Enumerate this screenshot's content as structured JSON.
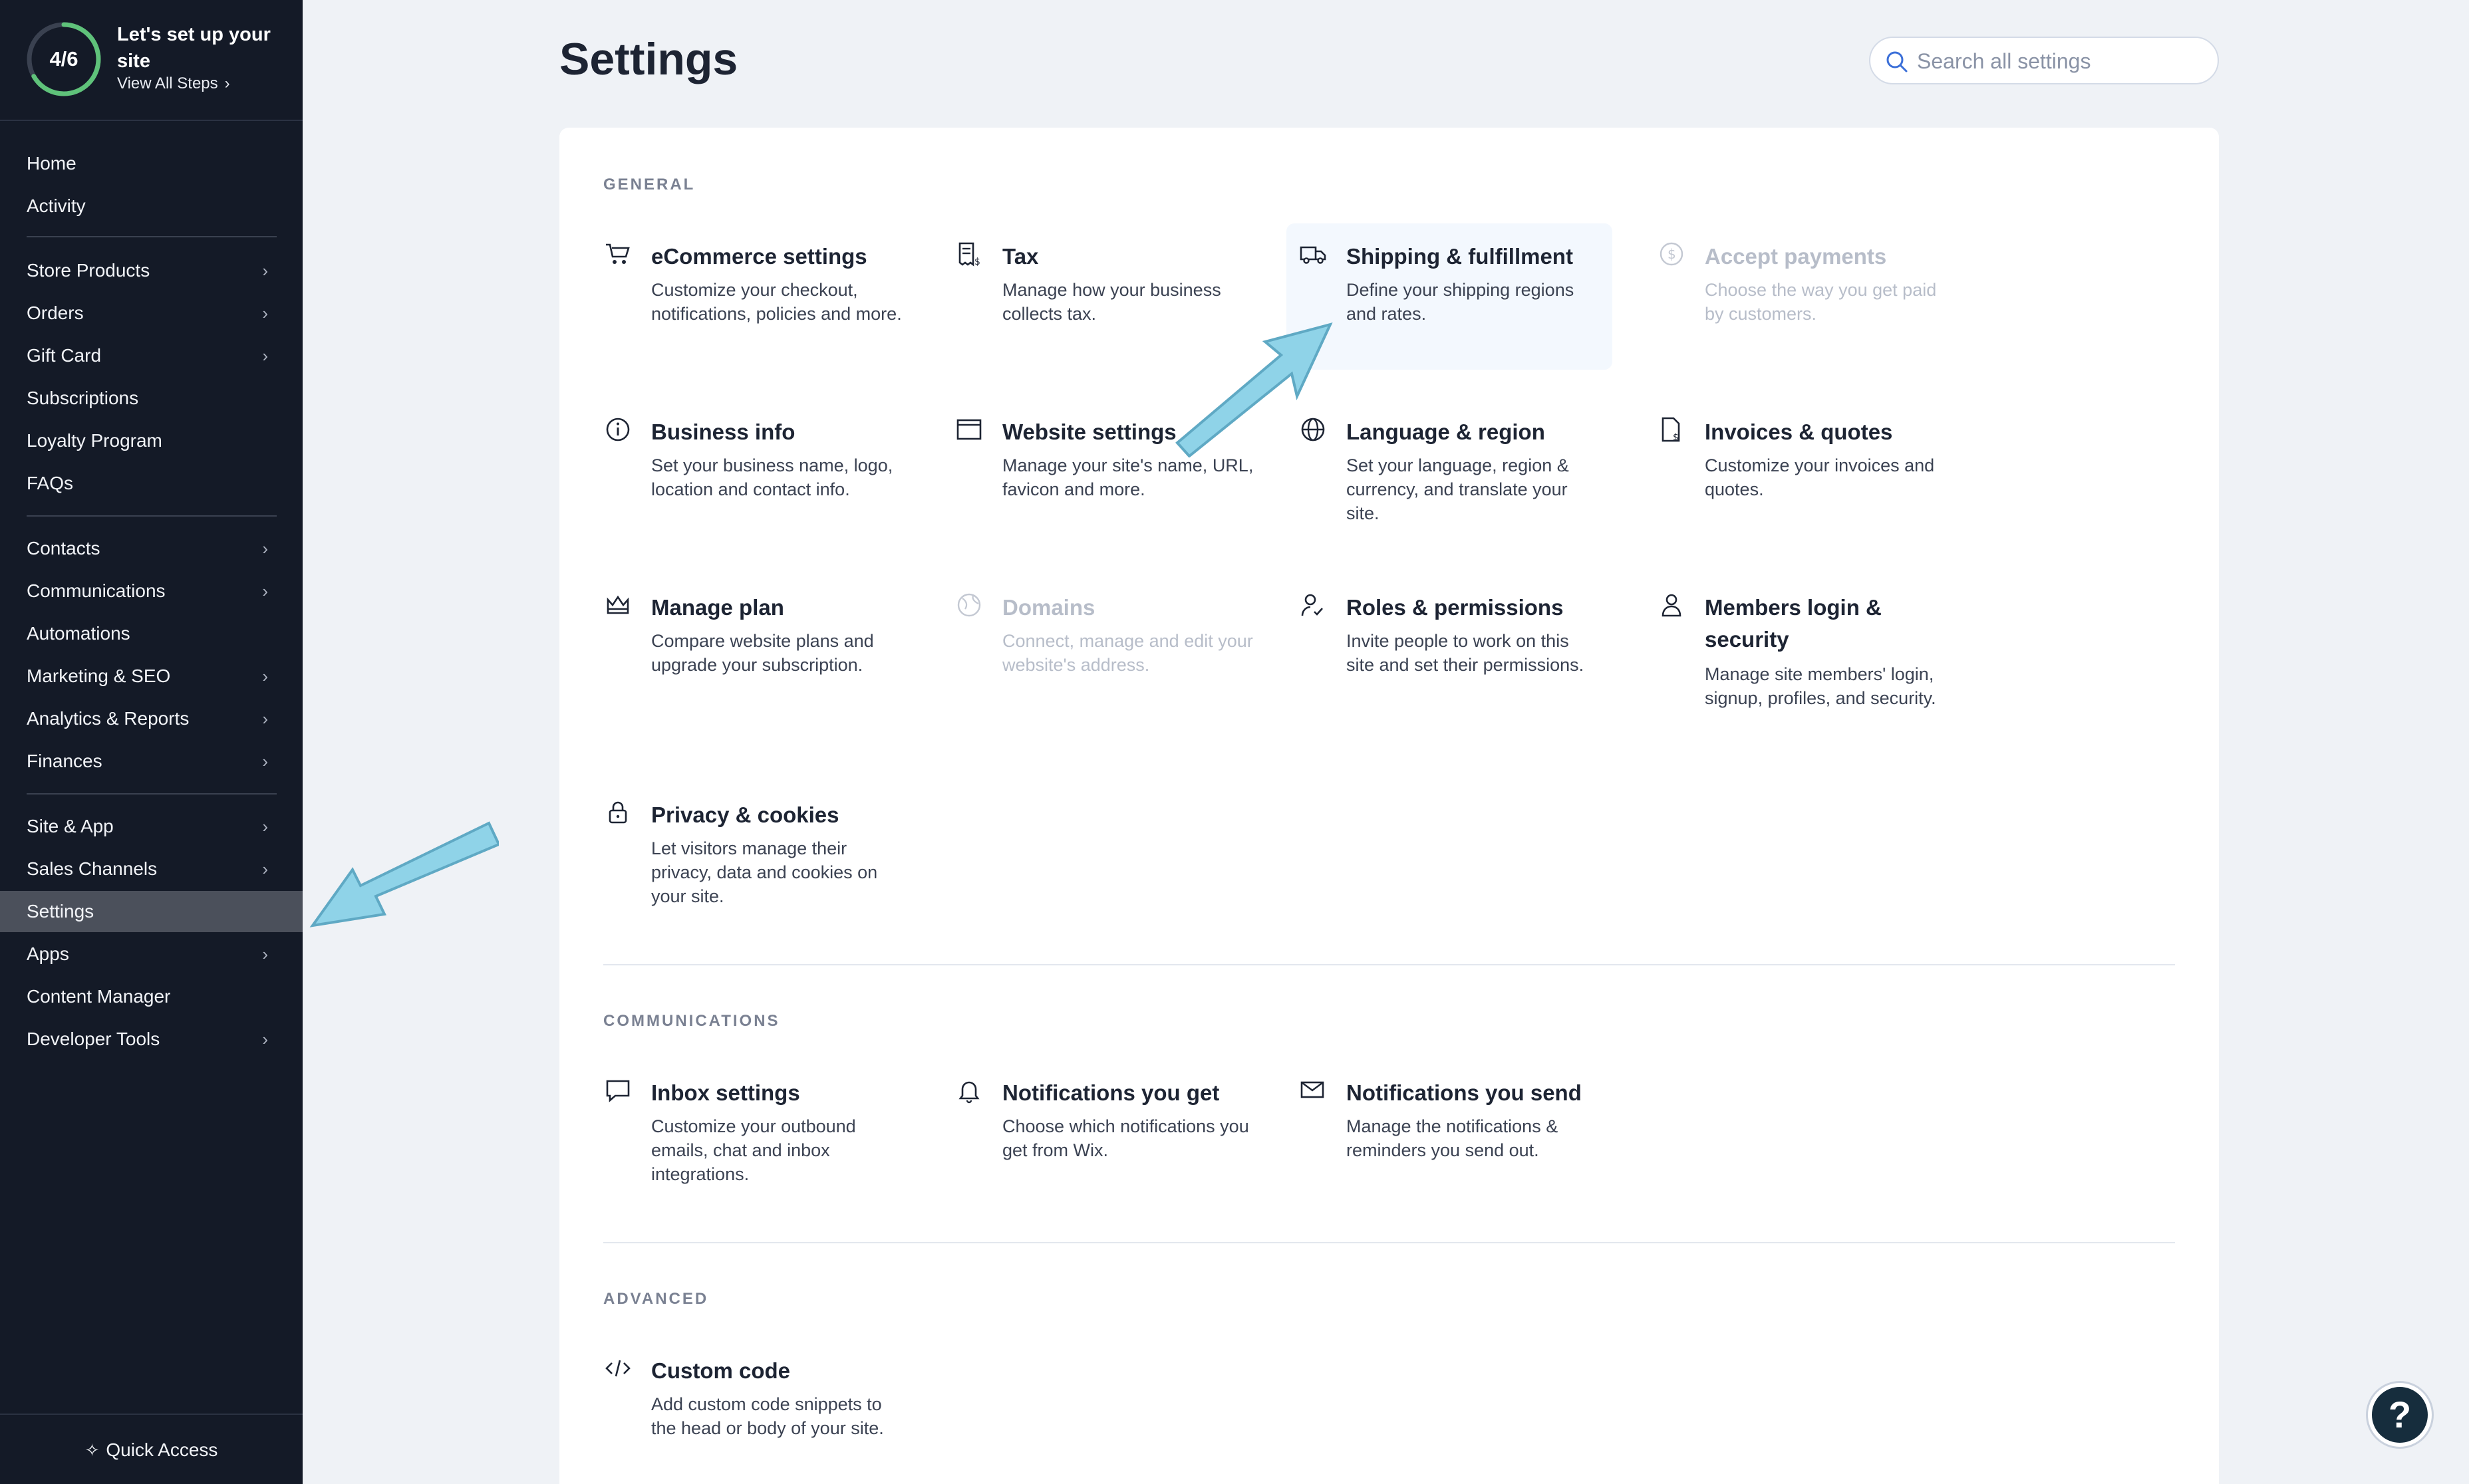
{
  "setup": {
    "progress": "4/6",
    "progress_fraction": 0.667,
    "title": "Let's set up your site",
    "view_steps": "View All Steps"
  },
  "nav": {
    "home": "Home",
    "activity": "Activity",
    "store_products": "Store Products",
    "orders": "Orders",
    "gift_card": "Gift Card",
    "subscriptions": "Subscriptions",
    "loyalty_program": "Loyalty Program",
    "faqs": "FAQs",
    "contacts": "Contacts",
    "communications": "Communications",
    "automations": "Automations",
    "marketing_seo": "Marketing & SEO",
    "analytics_reports": "Analytics & Reports",
    "finances": "Finances",
    "site_app": "Site & App",
    "sales_channels": "Sales Channels",
    "settings": "Settings",
    "apps": "Apps",
    "content_manager": "Content Manager",
    "developer_tools": "Developer Tools",
    "quick_access": "Quick Access",
    "chevron": "›"
  },
  "main": {
    "title": "Settings",
    "search_placeholder": "Search all settings"
  },
  "sections": {
    "general": "GENERAL",
    "communications": "COMMUNICATIONS",
    "advanced": "ADVANCED"
  },
  "tiles": {
    "ecommerce": {
      "title": "eCommerce settings",
      "desc": "Customize your checkout, notifications, policies and more."
    },
    "tax": {
      "title": "Tax",
      "desc": "Manage how your business collects tax."
    },
    "shipping": {
      "title": "Shipping & fulfillment",
      "desc": "Define your shipping regions and rates."
    },
    "payments": {
      "title": "Accept payments",
      "desc": "Choose the way you get paid by customers."
    },
    "business": {
      "title": "Business info",
      "desc": "Set your business name, logo, location and contact info."
    },
    "website": {
      "title": "Website settings",
      "desc": "Manage your site's name, URL, favicon and more."
    },
    "language": {
      "title": "Language & region",
      "desc": "Set your language, region & currency, and translate your site."
    },
    "invoices": {
      "title": "Invoices & quotes",
      "desc": "Customize your invoices and quotes."
    },
    "plan": {
      "title": "Manage plan",
      "desc": "Compare website plans and upgrade your subscription."
    },
    "domains": {
      "title": "Domains",
      "desc": "Connect, manage and edit your website's address."
    },
    "roles": {
      "title": "Roles & permissions",
      "desc": "Invite people to work on this site and set their permissions."
    },
    "members": {
      "title": "Members login & security",
      "desc": "Manage site members' login, signup, profiles, and security."
    },
    "privacy": {
      "title": "Privacy & cookies",
      "desc": "Let visitors manage their privacy, data and cookies on your site."
    },
    "inbox": {
      "title": "Inbox settings",
      "desc": "Customize your outbound emails, chat and inbox integrations."
    },
    "notif_get": {
      "title": "Notifications you get",
      "desc": "Choose which notifications you get from Wix."
    },
    "notif_send": {
      "title": "Notifications you send",
      "desc": "Manage the notifications & reminders you send out."
    },
    "custom_code": {
      "title": "Custom code",
      "desc": "Add custom code snippets to the head or body of your site."
    }
  },
  "help": {
    "label": "?"
  },
  "colors": {
    "sidebar_bg": "#141a27",
    "accent_green": "#5fc27a",
    "annotation_arrow": "#8fd3e8"
  }
}
